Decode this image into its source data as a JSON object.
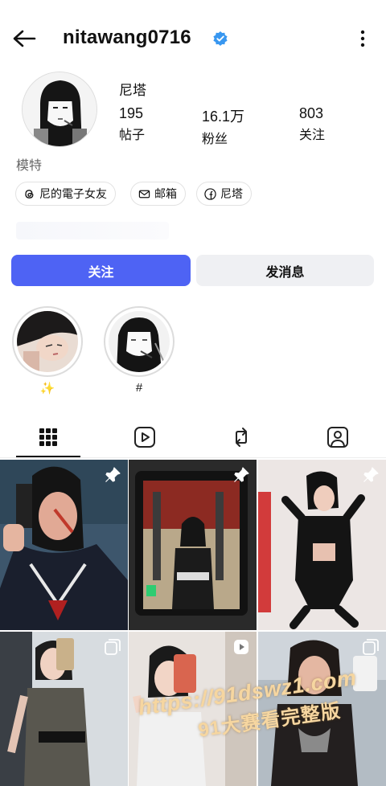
{
  "header": {
    "username": "nitawang0716",
    "back_icon": "arrow-left-icon",
    "verified_icon": "verified-badge-icon",
    "more_icon": "more-vertical-icon",
    "verified_color": "#3897f0"
  },
  "profile": {
    "display_name": "尼塔",
    "category": "模特",
    "stats": [
      {
        "value": "195",
        "label": "帖子"
      },
      {
        "value": "16.1万",
        "label": "粉丝"
      },
      {
        "value": "803",
        "label": "关注"
      }
    ],
    "links": [
      {
        "label": "尼的電子女友",
        "icon": "threads-icon"
      },
      {
        "label": "邮箱",
        "icon": "mail-icon"
      },
      {
        "label": "尼塔",
        "icon": "facebook-icon"
      }
    ]
  },
  "actions": {
    "follow_label": "关注",
    "message_label": "发消息",
    "follow_color": "#4e63f4"
  },
  "highlights": [
    {
      "label": "✨"
    },
    {
      "label": "#"
    }
  ],
  "tabs": [
    {
      "icon": "grid-icon",
      "active": true
    },
    {
      "icon": "reels-icon",
      "active": false
    },
    {
      "icon": "repost-icon",
      "active": false
    },
    {
      "icon": "tagged-icon",
      "active": false
    }
  ],
  "posts": [
    {
      "badge": "pin-icon"
    },
    {
      "badge": "pin-icon"
    },
    {
      "badge": "pin-icon"
    },
    {
      "badge": "carousel-icon"
    },
    {
      "badge": "reel-icon"
    },
    {
      "badge": "carousel-icon"
    }
  ],
  "watermark": {
    "line1": "https://91dswz1.com",
    "line2": "91大赛看完整版"
  }
}
